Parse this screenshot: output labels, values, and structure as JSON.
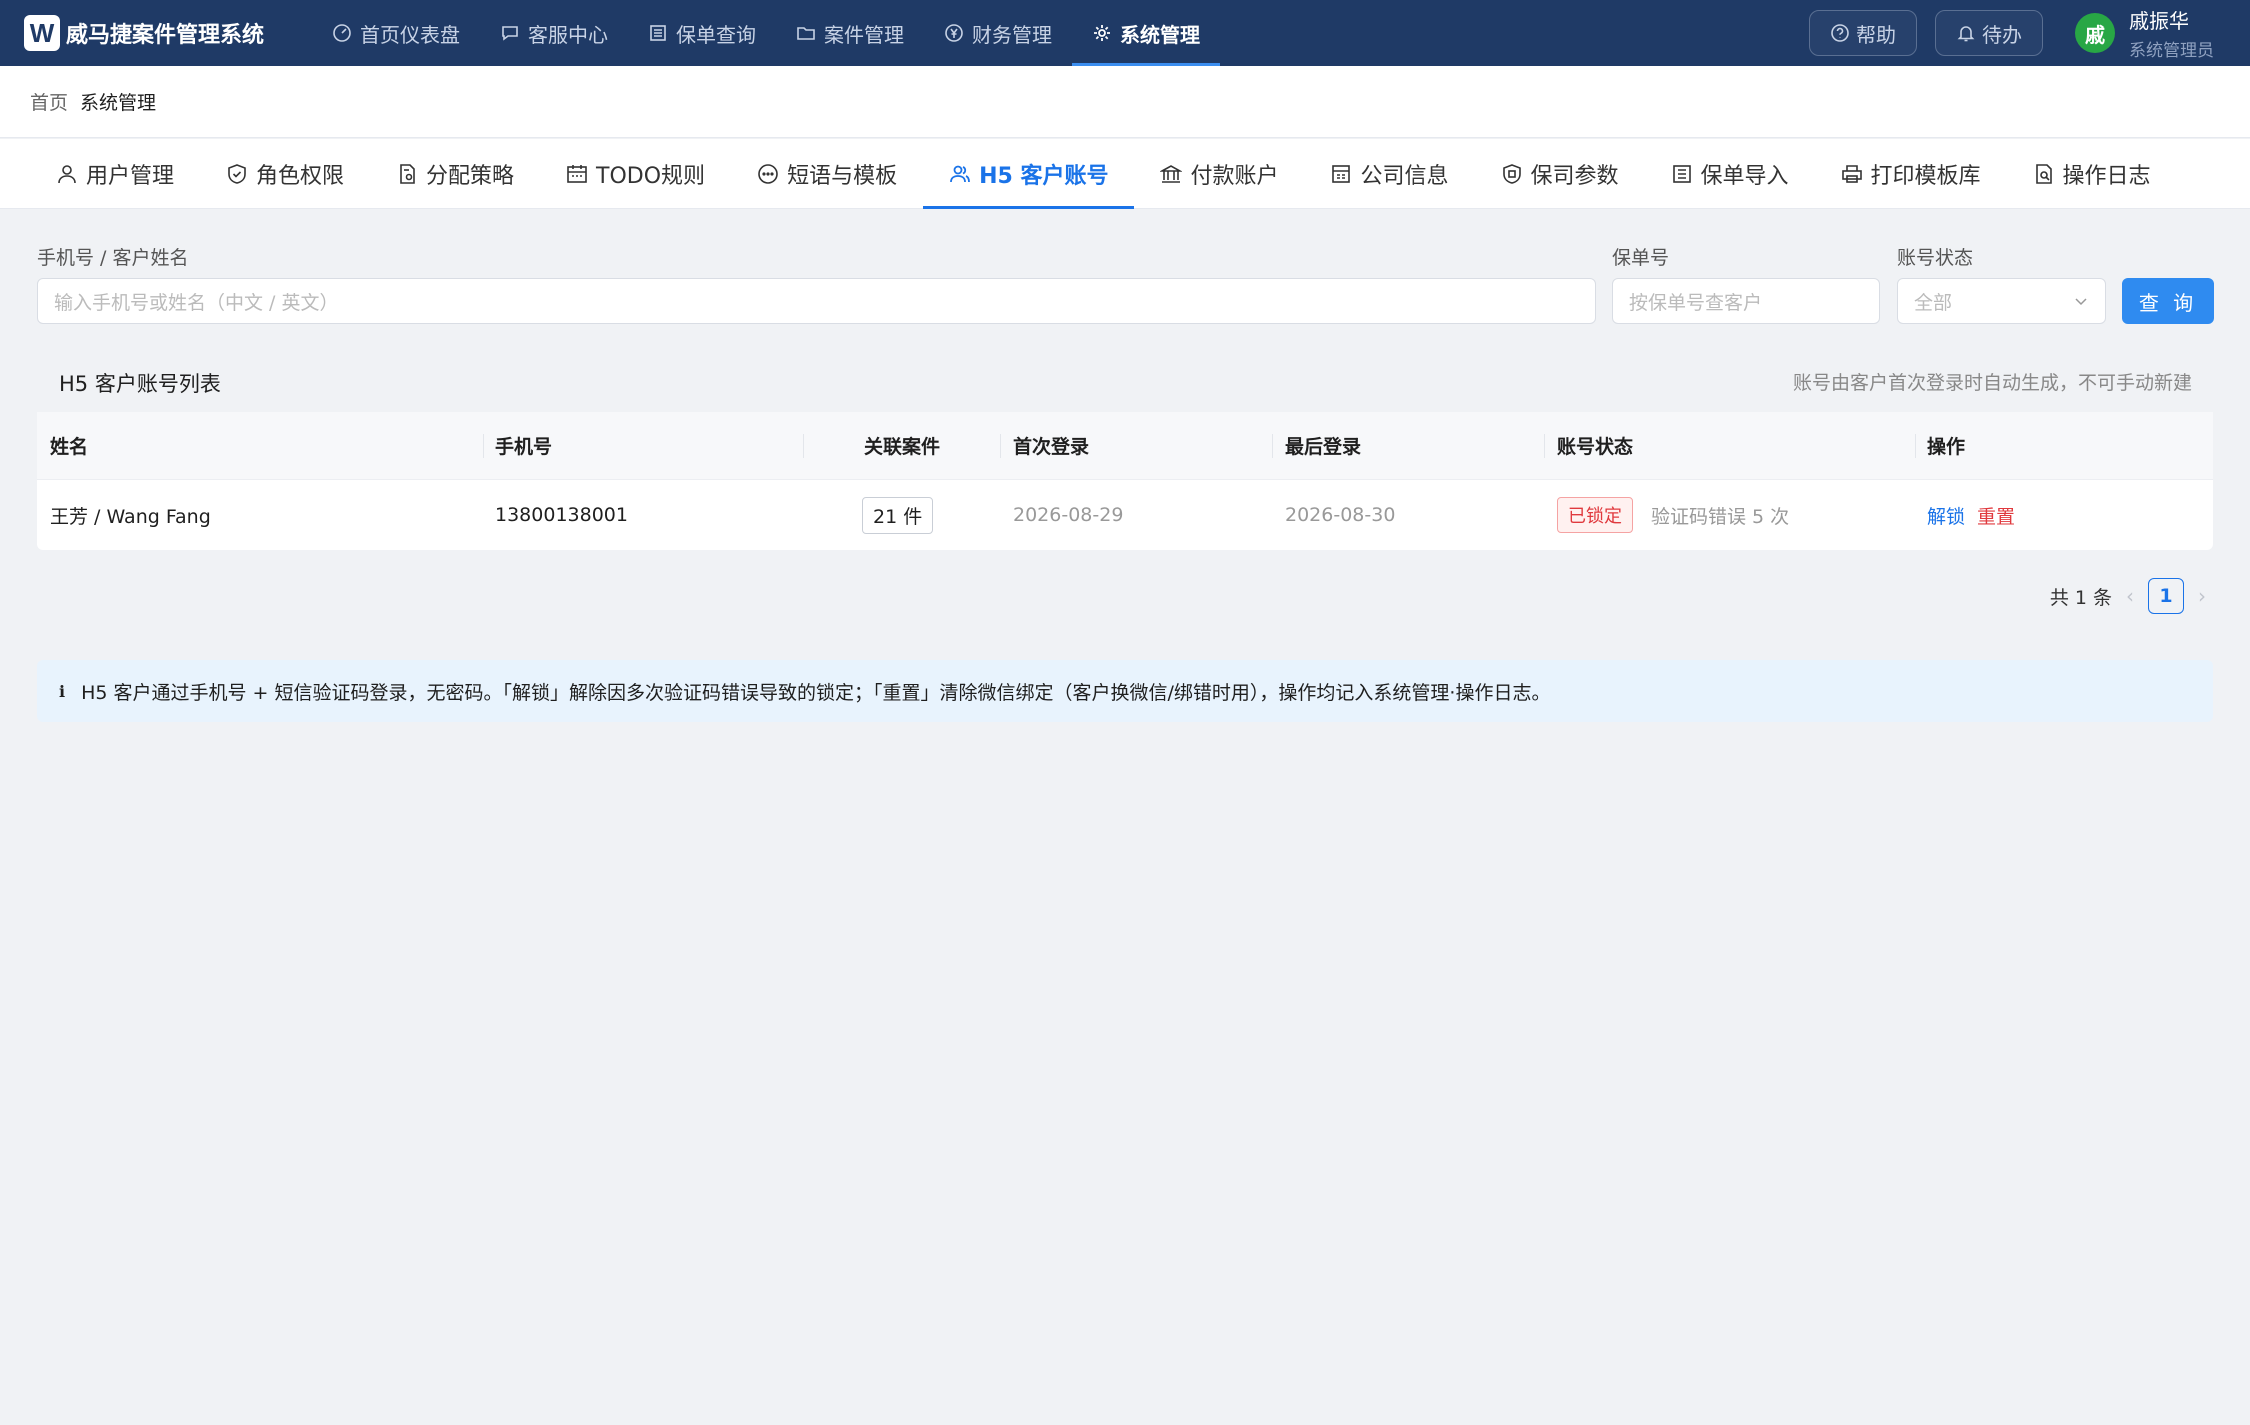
{
  "app": {
    "logo_letter": "W",
    "title": "威马捷案件管理系统"
  },
  "main_nav": [
    {
      "label": "首页仪表盘",
      "icon": "gauge-icon"
    },
    {
      "label": "客服中心",
      "icon": "chat-icon"
    },
    {
      "label": "保单查询",
      "icon": "list-icon"
    },
    {
      "label": "案件管理",
      "icon": "folder-icon"
    },
    {
      "label": "财务管理",
      "icon": "yen-icon"
    },
    {
      "label": "系统管理",
      "icon": "gear-icon",
      "active": true
    }
  ],
  "top_right": {
    "help_label": "帮助",
    "todo_label": "待办"
  },
  "user": {
    "avatar_char": "戚",
    "name": "戚振华",
    "role": "系统管理员"
  },
  "breadcrumb": {
    "home": "首页",
    "current": "系统管理"
  },
  "sub_tabs": [
    {
      "label": "用户管理",
      "icon": "user-icon"
    },
    {
      "label": "角色权限",
      "icon": "shield-check-icon"
    },
    {
      "label": "分配策略",
      "icon": "doc-settings-icon"
    },
    {
      "label": "TODO规则",
      "icon": "calendar-icon"
    },
    {
      "label": "短语与模板",
      "icon": "message-icon"
    },
    {
      "label": "H5 客户账号",
      "icon": "users-icon",
      "active": true
    },
    {
      "label": "付款账户",
      "icon": "bank-icon"
    },
    {
      "label": "公司信息",
      "icon": "building-icon"
    },
    {
      "label": "保司参数",
      "icon": "shield-icon"
    },
    {
      "label": "保单导入",
      "icon": "import-icon"
    },
    {
      "label": "打印模板库",
      "icon": "printer-icon"
    },
    {
      "label": "操作日志",
      "icon": "log-icon"
    }
  ],
  "filters": {
    "phone_label": "手机号 / 客户姓名",
    "phone_placeholder": "输入手机号或姓名（中文 / 英文）",
    "policy_label": "保单号",
    "policy_placeholder": "按保单号查客户",
    "status_label": "账号状态",
    "status_value": "全部",
    "query_button": "查 询"
  },
  "list": {
    "title": "H5 客户账号列表",
    "note": "账号由客户首次登录时自动生成，不可手动新建",
    "columns": [
      "姓名",
      "手机号",
      "关联案件",
      "首次登录",
      "最后登录",
      "账号状态",
      "操作"
    ],
    "rows": [
      {
        "name": "王芳 / Wang Fang",
        "phone": "13800138001",
        "cases": "21 件",
        "first_login": "2026-08-29",
        "last_login": "2026-08-30",
        "status": "已锁定",
        "status_reason": "验证码错误 5 次",
        "actions": [
          "解锁",
          "重置"
        ]
      }
    ]
  },
  "pagination": {
    "total": "共 1 条",
    "current_page": "1",
    "prev": "‹",
    "next": "›"
  },
  "info": {
    "icon": "i",
    "text": "H5 客户通过手机号 + 短信验证码登录，无密码。「解锁」解除因多次验证码错误导致的锁定；「重置」清除微信绑定（客户换微信/绑错时用），操作均记入系统管理·操作日志。"
  },
  "colors": {
    "topbar": "#1f3a66",
    "accent": "#1a73e8",
    "danger": "#e0393e",
    "avatar": "#28a745"
  }
}
